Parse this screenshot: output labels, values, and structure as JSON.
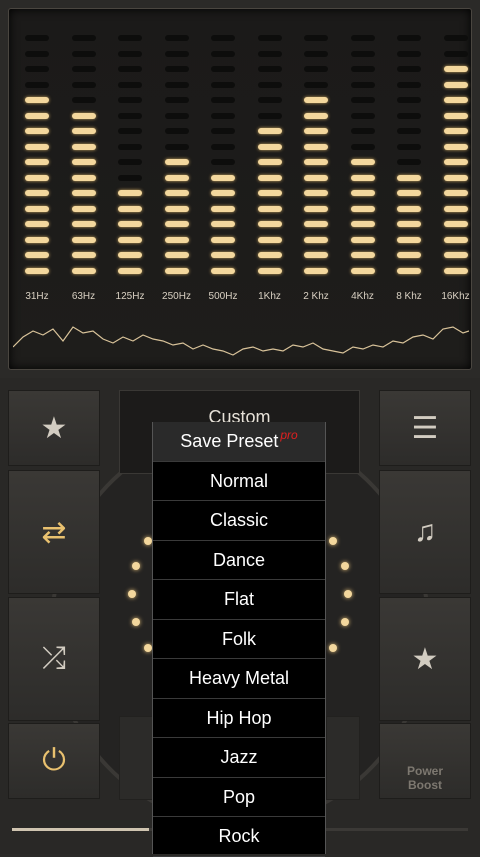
{
  "equalizer": {
    "bands": [
      {
        "label": "31Hz",
        "level": 12
      },
      {
        "label": "63Hz",
        "level": 11
      },
      {
        "label": "125Hz",
        "level": 6
      },
      {
        "label": "250Hz",
        "level": 8
      },
      {
        "label": "500Hz",
        "level": 7
      },
      {
        "label": "1Khz",
        "level": 10
      },
      {
        "label": "2 Khz",
        "level": 12
      },
      {
        "label": "4Khz",
        "level": 8
      },
      {
        "label": "8 Khz",
        "level": 7
      },
      {
        "label": "16Khz",
        "level": 14
      }
    ],
    "segments_per_band": 16
  },
  "preset": {
    "current": "Custom"
  },
  "menu": {
    "items": [
      "Save Preset",
      "Normal",
      "Classic",
      "Dance",
      "Flat",
      "Folk",
      "Heavy Metal",
      "Hip Hop",
      "Jazz",
      "Pop",
      "Rock"
    ],
    "pro_badge": "pro"
  },
  "buttons": {
    "power_boost_line1": "Power",
    "power_boost_line2": "Boost"
  },
  "playback": {
    "progress": 0.3
  },
  "colors": {
    "accent": "#f3d79d",
    "icon_gold": "#e9c16f",
    "pro_red": "#e02020"
  }
}
